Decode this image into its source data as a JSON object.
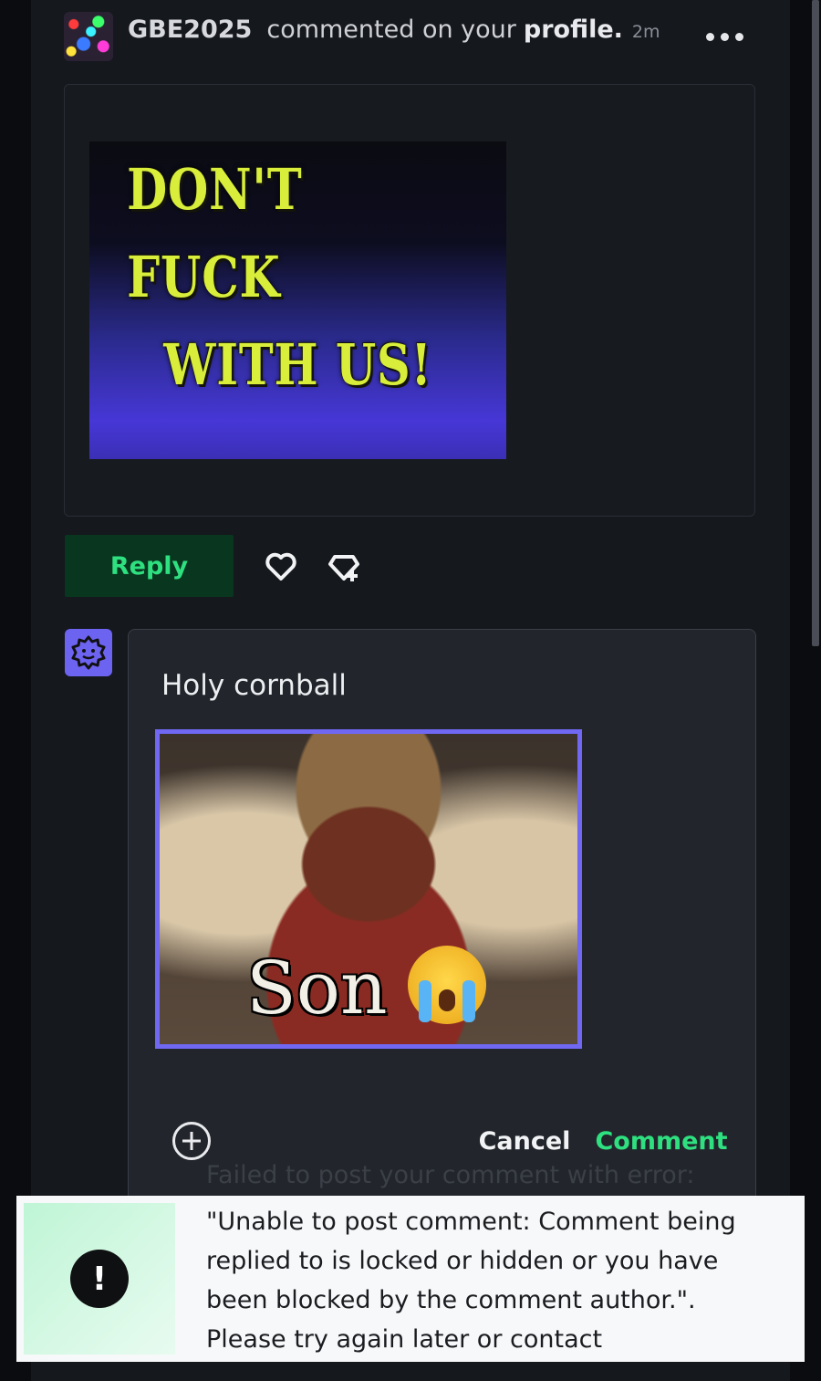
{
  "notification": {
    "username": "GBE2025",
    "action_text": "commented on your",
    "target": "profile.",
    "time_ago": "2m"
  },
  "original_comment": {
    "gif_caption_line1": "DON'T FUCK",
    "gif_caption_line2": "WITH US!"
  },
  "actions": {
    "reply_label": "Reply",
    "like_icon": "heart-icon",
    "award_icon": "award-add-icon"
  },
  "composer": {
    "draft_text": "Holy cornball",
    "gif_caption": "Son",
    "gif_emoji": "loudly-crying-face",
    "cancel_label": "Cancel",
    "submit_label": "Comment"
  },
  "toast": {
    "icon": "!",
    "hidden_line": "Failed to post your comment with error:",
    "message": "\"Unable to post comment: Comment being replied to is locked or hidden or you have been blocked by the comment author.\". Please try again later or contact",
    "accent": "#2ee07f"
  }
}
